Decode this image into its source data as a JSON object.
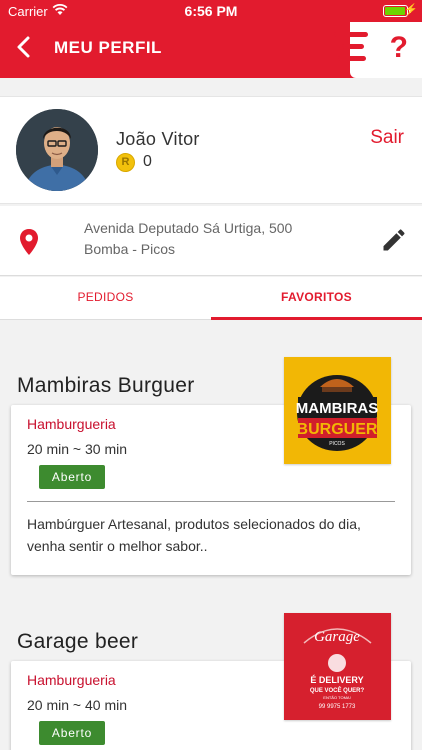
{
  "status_bar": {
    "carrier": "Carrier",
    "time": "6:56 PM"
  },
  "header": {
    "title": "MEU PERFIL",
    "help_label": "?"
  },
  "profile": {
    "name": "João Vitor",
    "coin_symbol": "R",
    "points": "0",
    "logout_label": "Sair"
  },
  "address": {
    "line1": "Avenida Deputado Sá Urtiga, 500",
    "line2": "Bomba - Picos"
  },
  "tabs": [
    {
      "label": "PEDIDOS",
      "selected": false
    },
    {
      "label": "FAVORITOS",
      "selected": true
    }
  ],
  "restaurants": [
    {
      "name": "Mambiras Burguer",
      "category": "Hamburgueria",
      "eta": "20 min ~ 30 min",
      "status": "Aberto",
      "description": "Hambúrguer Artesanal, produtos selecionados do dia, venha sentir o melhor sabor..",
      "logo_text": {
        "line1": "MAMBIRAS",
        "line2": "BURGUER",
        "line3": "PICOS"
      }
    },
    {
      "name": "Garage beer",
      "category": "Hamburgueria",
      "eta": "20 min ~ 40 min",
      "status": "Aberto",
      "logo_text": {
        "line1": "Garage",
        "line2": "É DELIVERY",
        "line3": "QUE VOCÊ QUER?",
        "line4": "ENTÃO TOMA!",
        "line5": "99 9975 1773"
      }
    }
  ],
  "colors": {
    "primary": "#e21b2e",
    "open_badge": "#3d8b2f",
    "category": "#c8102e"
  },
  "icons": [
    "back-arrow-icon",
    "wifi-icon",
    "battery-icon",
    "help-icon",
    "coin-icon",
    "location-pin-icon",
    "edit-pencil-icon"
  ]
}
